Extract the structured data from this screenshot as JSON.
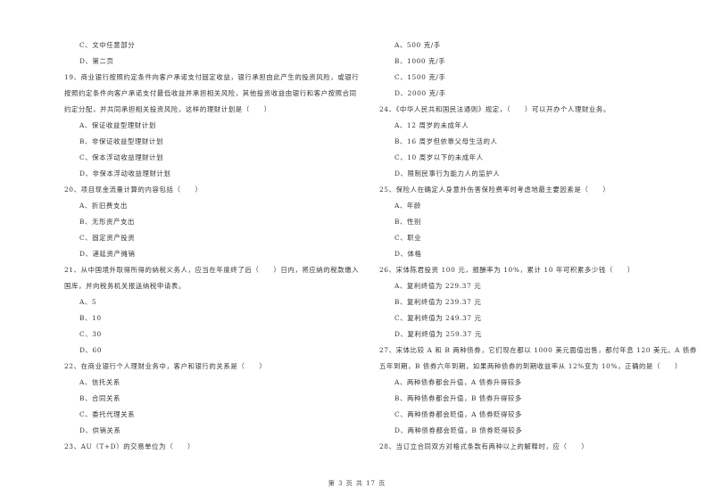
{
  "page": {
    "footer": "第 3 页 共 17 页"
  },
  "left_column": [
    {
      "kind": "option",
      "text": "C、文中任意部分"
    },
    {
      "kind": "option",
      "text": "D、第二页"
    },
    {
      "kind": "stem",
      "text": "19、商业银行按照约定条件向客户承诺支付固定收益，银行承担由此产生的投资风险，或银行"
    },
    {
      "kind": "stem-cont",
      "text": "按照约定条件向客户承诺支付最低收益并承担相关风险，其他投资收益由银行和客户按照合同"
    },
    {
      "kind": "stem-cont",
      "text": "约定分配，并共同承担相关投资风险，这样的理财计划是（　　）"
    },
    {
      "kind": "option",
      "text": "A、保证收益型理财计划"
    },
    {
      "kind": "option",
      "text": "B、非保证收益型理财计划"
    },
    {
      "kind": "option",
      "text": "C、保本浮动收益理财计划"
    },
    {
      "kind": "option",
      "text": "D、非保本浮动收益理财计划"
    },
    {
      "kind": "stem",
      "text": "20、项目现金流量计算的内容包括（　　）"
    },
    {
      "kind": "option",
      "text": "A、折旧费支出"
    },
    {
      "kind": "option",
      "text": "B、无形资产支出"
    },
    {
      "kind": "option",
      "text": "C、固定资产投资"
    },
    {
      "kind": "option",
      "text": "D、递延资产摊销"
    },
    {
      "kind": "stem",
      "text": "21、从中国境外取得所得的纳税义务人，应当在年度终了后（　　）日内，将应纳的税款缴入"
    },
    {
      "kind": "stem-cont",
      "text": "国库，并向税务机关报送纳税申请表。"
    },
    {
      "kind": "option",
      "text": "A、5"
    },
    {
      "kind": "option",
      "text": "B、10"
    },
    {
      "kind": "option",
      "text": "C、30"
    },
    {
      "kind": "option",
      "text": "D、60"
    },
    {
      "kind": "stem",
      "text": "22、在商业银行个人理财业务中，客户和银行的关系是（　　）"
    },
    {
      "kind": "option",
      "text": "A、信托关系"
    },
    {
      "kind": "option",
      "text": "B、合同关系"
    },
    {
      "kind": "option",
      "text": "C、委托代理关系"
    },
    {
      "kind": "option",
      "text": "D、供销关系"
    },
    {
      "kind": "stem",
      "text": "23、AU（T+D）的交易单位为（　　）"
    }
  ],
  "right_column": [
    {
      "kind": "option",
      "text": "A、500 克/手"
    },
    {
      "kind": "option",
      "text": "B、1000 克/手"
    },
    {
      "kind": "option",
      "text": "C、1500 克/手"
    },
    {
      "kind": "option",
      "text": "D、2000 克/手"
    },
    {
      "kind": "stem",
      "text": "24、《中华人民共和国民法通则》规定，（　　）可以开办个人理财业务。"
    },
    {
      "kind": "option",
      "text": "A、12 周岁的未成年人"
    },
    {
      "kind": "option",
      "text": "B、16 周岁但依靠父母生活的人"
    },
    {
      "kind": "option",
      "text": "C、10 周岁以下的未成年人"
    },
    {
      "kind": "option",
      "text": "D、限制民事行为能力人的监护人"
    },
    {
      "kind": "stem",
      "text": "25、保险人在确定人身意外伤害保险费率时考虑地最主要因素是（　　）"
    },
    {
      "kind": "option",
      "text": "A、年龄"
    },
    {
      "kind": "option",
      "text": "B、性别"
    },
    {
      "kind": "option",
      "text": "C、职业"
    },
    {
      "kind": "option",
      "text": "D、体格"
    },
    {
      "kind": "stem",
      "text": "26、宋体陈君投资 100 元，报酬率为 10%，累计 10 年可积累多少钱（　　）"
    },
    {
      "kind": "option",
      "text": "A、复利终值为 229.37 元"
    },
    {
      "kind": "option",
      "text": "B、复利终值为 239.37 元"
    },
    {
      "kind": "option",
      "text": "C、复利终值为 249.37 元"
    },
    {
      "kind": "option",
      "text": "D、复利终值为 259.37 元"
    },
    {
      "kind": "stem",
      "text": "27、宋体比较 A 和 B 两种债券，它们现在都以 1000 美元面值出售，都付年息 120 美元。A 债券"
    },
    {
      "kind": "stem-cont",
      "text": "五年到期，B 债券六年到期，如果两种债券的到期收益率从 12%变为 10%，正确的是（　　）"
    },
    {
      "kind": "option",
      "text": "A、两种债券都会升值，A 债券升得较多"
    },
    {
      "kind": "option",
      "text": "B、两种债券都会升值，B 债券升得较多"
    },
    {
      "kind": "option",
      "text": "C、两种债券都会贬值，A 债券贬得较多"
    },
    {
      "kind": "option",
      "text": "D、两种债券都会贬值，B 债券贬得较多"
    },
    {
      "kind": "stem",
      "text": "28、当订立合同双方对格式条款有两种以上的解释时，应（　　）"
    }
  ]
}
